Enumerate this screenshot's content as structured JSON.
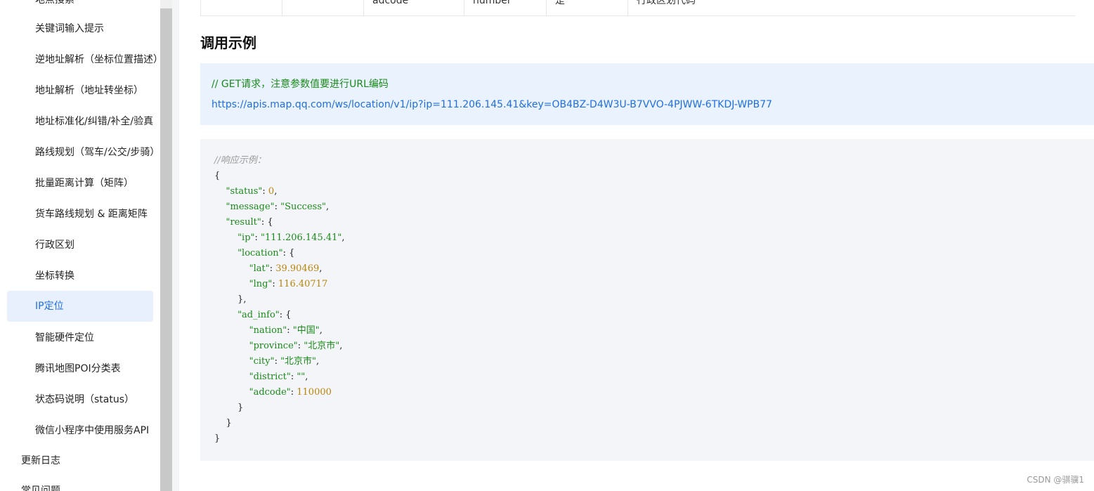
{
  "sidebar": {
    "items": [
      {
        "label": "地点搜索",
        "active": false
      },
      {
        "label": "关键词输入提示",
        "active": false
      },
      {
        "label": "逆地址解析（坐标位置描述）",
        "active": false
      },
      {
        "label": "地址解析（地址转坐标）",
        "active": false
      },
      {
        "label": "地址标准化/纠错/补全/验真",
        "active": false
      },
      {
        "label": "路线规划（驾车/公交/步骑）",
        "active": false
      },
      {
        "label": "批量距离计算（矩阵）",
        "active": false
      },
      {
        "label": "货车路线规划 & 距离矩阵",
        "active": false
      },
      {
        "label": "行政区划",
        "active": false
      },
      {
        "label": "坐标转换",
        "active": false
      },
      {
        "label": "IP定位",
        "active": true
      },
      {
        "label": "智能硬件定位",
        "active": false
      },
      {
        "label": "腾讯地图POI分类表",
        "active": false
      },
      {
        "label": "状态码说明（status）",
        "active": false
      },
      {
        "label": "微信小程序中使用服务API",
        "active": false
      }
    ],
    "top_items": [
      {
        "label": "更新日志"
      },
      {
        "label": "常见问题"
      }
    ]
  },
  "table_fragment": {
    "cells": [
      "",
      "",
      "adcode",
      "number",
      "是",
      "行政区划代码"
    ]
  },
  "section": {
    "title": "调用示例"
  },
  "call_example": {
    "comment": "// GET请求，注意参数值要进行URL编码",
    "url": "https://apis.map.qq.com/ws/location/v1/ip?ip=111.206.145.41&key=OB4BZ-D4W3U-B7VVO-4PJWW-6TKDJ-WPB77"
  },
  "response_example": {
    "comment": "//响应示例：",
    "status": "0",
    "message": "\"Success\"",
    "ip": "\"111.206.145.41\"",
    "lat": "39.90469",
    "lng": "116.40717",
    "nation": "\"中国\"",
    "province": "\"北京市\"",
    "city": "\"北京市\"",
    "district": "\"\"",
    "adcode": "110000"
  },
  "watermark": "CSDN @骐骥1"
}
